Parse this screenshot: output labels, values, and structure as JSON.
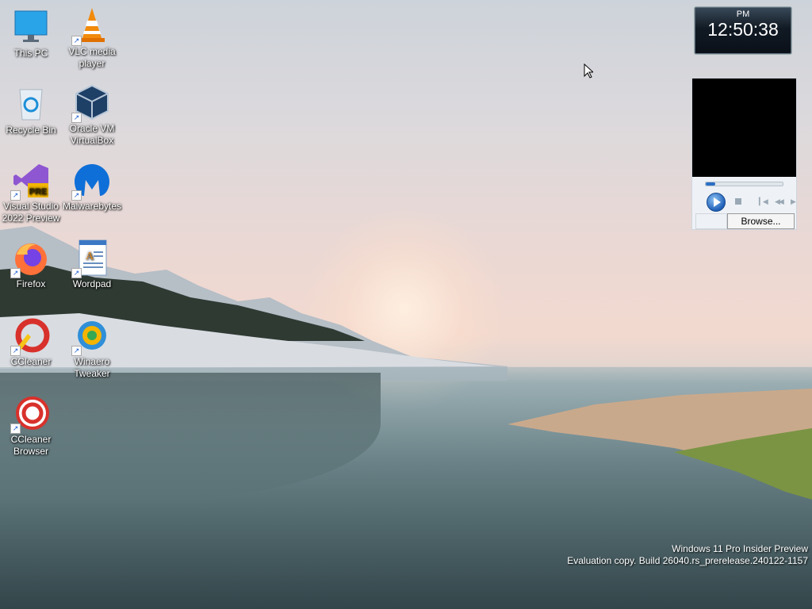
{
  "desktop": {
    "icons": [
      {
        "label": "This PC",
        "icon": "monitor-icon",
        "shortcut": false
      },
      {
        "label": "VLC media player",
        "icon": "vlc-cone-icon",
        "shortcut": true
      },
      {
        "label": "Recycle Bin",
        "icon": "recycle-bin-icon",
        "shortcut": false
      },
      {
        "label": "Oracle VM VirtualBox",
        "icon": "virtualbox-cube-icon",
        "shortcut": true
      },
      {
        "label": "Visual Studio 2022 Preview",
        "icon": "visual-studio-preview-icon",
        "shortcut": true
      },
      {
        "label": "Malwarebytes",
        "icon": "malwarebytes-icon",
        "shortcut": true
      },
      {
        "label": "Firefox",
        "icon": "firefox-icon",
        "shortcut": true
      },
      {
        "label": "Wordpad",
        "icon": "wordpad-icon",
        "shortcut": true
      },
      {
        "label": "CCleaner",
        "icon": "ccleaner-icon",
        "shortcut": true
      },
      {
        "label": "Winaero Tweaker",
        "icon": "winaero-tweaker-icon",
        "shortcut": true
      },
      {
        "label": "CCleaner Browser",
        "icon": "ccleaner-browser-icon",
        "shortcut": true
      }
    ]
  },
  "clock_gadget": {
    "ampm": "PM",
    "time": "12:50:38"
  },
  "media_gadget": {
    "browse_label": "Browse...",
    "seek_progress": 0.12
  },
  "watermark": {
    "line1": "Windows 11 Pro Insider Preview",
    "line2": "Evaluation copy. Build 26040.rs_prerelease.240122-1157"
  }
}
